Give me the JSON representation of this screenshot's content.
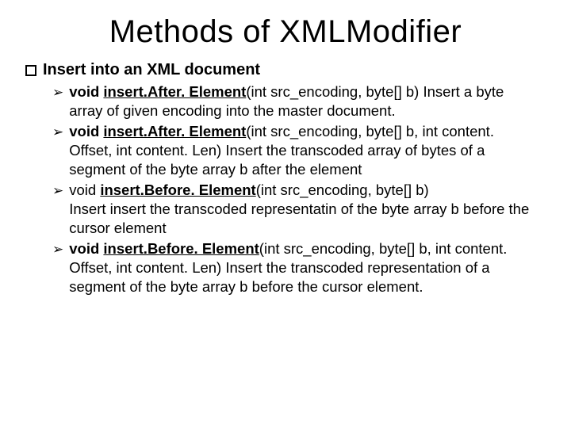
{
  "title": "Methods of XMLModifier",
  "section_label": "Insert into an XML document",
  "items": [
    {
      "ret_bold": true,
      "ret": "void ",
      "method": "insert.After. Element",
      "sig": "(int src_encoding, byte[] b)",
      "desc": " Insert a byte array of given encoding into the master document."
    },
    {
      "ret_bold": true,
      "ret": "void ",
      "method": "insert.After. Element",
      "sig": "(int src_encoding, byte[] b, int content. Offset, int content. Len)",
      "desc": " Insert the transcoded array of bytes of a segment of the byte array b after the element"
    },
    {
      "ret_bold": false,
      "ret": "void ",
      "method": "insert.Before. Element",
      "sig": "(int src_encoding, byte[] b)",
      "desc": " Insert insert the transcoded representatin of the byte array b before the cursor element"
    },
    {
      "ret_bold": true,
      "ret": "void ",
      "method": "insert.Before. Element",
      "sig": "(int src_encoding, byte[] b, int content. Offset, int content. Len)",
      "desc": " Insert the transcoded representation of a segment of the byte array b before the cursor element."
    }
  ]
}
